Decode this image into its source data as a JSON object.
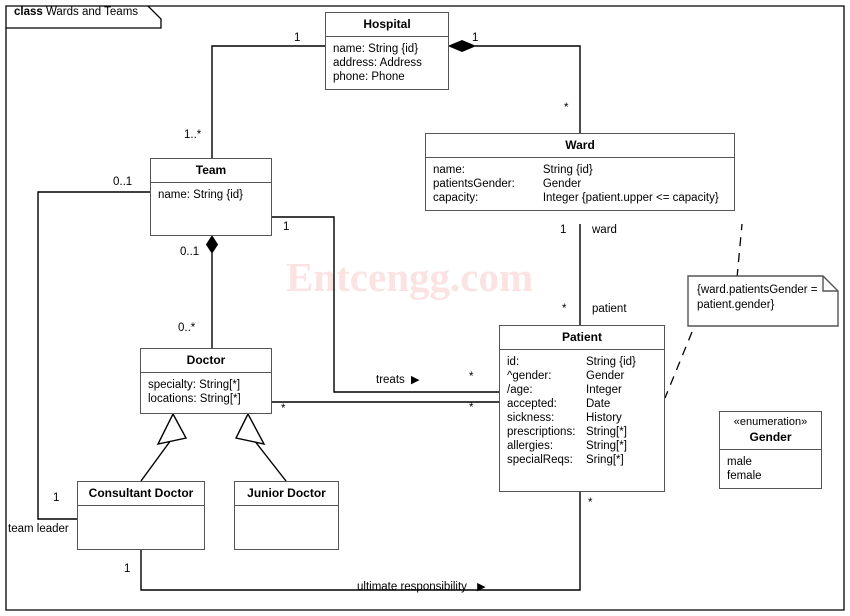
{
  "frame": {
    "keyword": "class",
    "title": "Wards and Teams"
  },
  "watermark": "Entcengg.com",
  "classes": {
    "hospital": {
      "name": "Hospital",
      "attributes": [
        {
          "name": "name:",
          "type": "String {id}"
        },
        {
          "name": "address:",
          "type": "Address"
        },
        {
          "name": "phone:",
          "type": "Phone"
        }
      ]
    },
    "ward": {
      "name": "Ward",
      "attributes": [
        {
          "name": "name:",
          "type": "String {id}"
        },
        {
          "name": "patientsGender:",
          "type": "Gender"
        },
        {
          "name": "capacity:",
          "type": "Integer {patient.upper <= capacity}"
        }
      ]
    },
    "team": {
      "name": "Team",
      "attributes": [
        {
          "name": "name: String {id}",
          "type": ""
        }
      ]
    },
    "patient": {
      "name": "Patient",
      "attributes": [
        {
          "name": "id:",
          "type": "String {id}"
        },
        {
          "name": "^gender:",
          "type": "Gender"
        },
        {
          "name": "/age:",
          "type": "Integer"
        },
        {
          "name": "accepted:",
          "type": "Date"
        },
        {
          "name": "sickness:",
          "type": "History"
        },
        {
          "name": "prescriptions:",
          "type": "String[*]"
        },
        {
          "name": "allergies:",
          "type": "String[*]"
        },
        {
          "name": "specialReqs:",
          "type": "Sring[*]"
        }
      ]
    },
    "doctor": {
      "name": "Doctor",
      "attributes": [
        {
          "name": "specialty: String[*]",
          "type": ""
        },
        {
          "name": "locations: String[*]",
          "type": ""
        }
      ]
    },
    "consultant_doctor": {
      "name": "Consultant Doctor",
      "attributes": []
    },
    "junior_doctor": {
      "name": "Junior Doctor",
      "attributes": []
    },
    "gender_enum": {
      "stereotype": "«enumeration»",
      "name": "Gender",
      "literals": [
        "male",
        "female"
      ]
    }
  },
  "note": {
    "line1": "{ward.patientsGender =",
    "line2": "patient.gender}"
  },
  "associations": {
    "treats_label": "treats",
    "treats_arrow": "▶",
    "ultimate_label": "ultimate responsibility",
    "ultimate_arrow": "▶",
    "team_leader_label": "team leader",
    "ward_role": "ward",
    "patient_role": "patient"
  },
  "multiplicities": {
    "hospital_team": "1",
    "hospital_ward": "1",
    "team_to_hospital": "1..*",
    "ward_to_hospital": "*",
    "team_leader_end": "0..1",
    "team_treats": "1",
    "team_doctor": "0..1",
    "doctor_team": "0..*",
    "doctor_treats": "*",
    "patient_treats": "*",
    "ward_patient_ward": "1",
    "ward_patient_patient": "*",
    "consultant_end": "1",
    "consultant_bottom": "1",
    "patient_bottom": "*"
  },
  "colors": {
    "stroke": "#555555",
    "line": "#000000",
    "background": "#ffffff",
    "watermark": "#fbe3e3"
  }
}
